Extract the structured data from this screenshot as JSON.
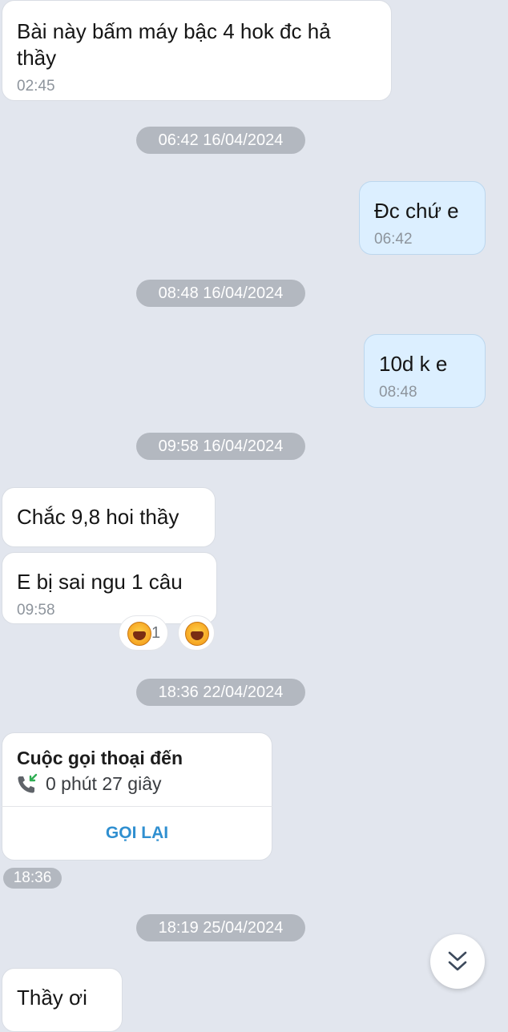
{
  "messages": {
    "m1": {
      "text_line1": "Bài này bấm máy bậc 4 hok đc hả",
      "text_line2": "thầy",
      "time": "02:45"
    },
    "m2": {
      "text": "Đc chứ e",
      "time": "06:42"
    },
    "m3": {
      "text": "10d k e",
      "time": "08:48"
    },
    "m4": {
      "text": "Chắc 9,8 hoi thầy"
    },
    "m5": {
      "text": "E bị sai ngu 1 câu",
      "time": "09:58"
    },
    "m6": {
      "text": "Thầy ơi"
    }
  },
  "date_separators": {
    "d1": "06:42 16/04/2024",
    "d2": "08:48 16/04/2024",
    "d3": "09:58 16/04/2024",
    "d4": "18:36 22/04/2024",
    "d5": "18:19 25/04/2024"
  },
  "reactions": {
    "count": "1",
    "emoji_icon": "laughing-face-emoji"
  },
  "call": {
    "title": "Cuộc gọi thoại đến",
    "duration": "0 phút 27 giây",
    "callback_label": "GỌI LẠI",
    "time": "18:36"
  },
  "colors": {
    "background": "#e2e6ee",
    "incoming_bubble": "#ffffff",
    "outgoing_bubble": "#dcefff",
    "accent": "#2f8fd0"
  },
  "scroll_button_icon": "double-chevron-down-icon"
}
